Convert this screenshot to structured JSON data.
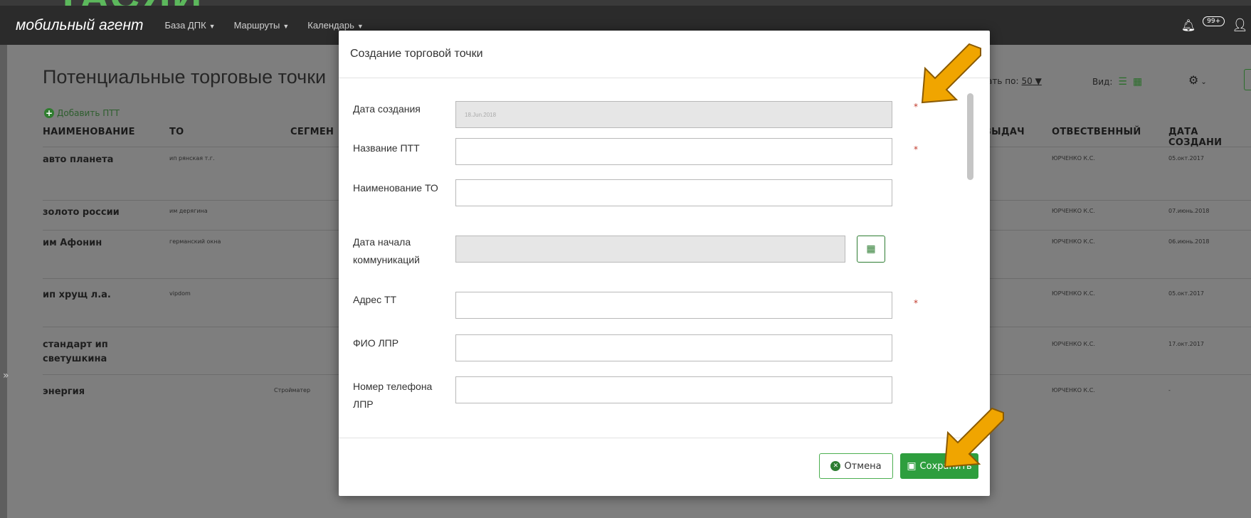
{
  "frame": {
    "title_fragment": "ТАСЯИ"
  },
  "nav": {
    "brand": "мобильный агент",
    "items": [
      {
        "label": "База ДПК"
      },
      {
        "label": "Маршруты"
      },
      {
        "label": "Календарь"
      }
    ],
    "badge": "99+",
    "icons": {
      "bell": "bell-icon",
      "user": "user-icon"
    }
  },
  "page": {
    "title": "Потенциальные торговые точки",
    "add_label": "Добавить ПТТ",
    "show_by_label": "вать по:",
    "show_by_value": "50",
    "view_label": "Вид:",
    "sidebar_toggle": "»"
  },
  "table": {
    "columns": {
      "name": "НАИМЕНОВАНИЕ",
      "to": "ТО",
      "segment": "СЕГМЕН",
      "issue": "I ВЫДАЧ",
      "responsible": "ОТВЕСТВЕННЫЙ",
      "created": "ДАТА СОЗДАНИ"
    },
    "rows": [
      {
        "name": "авто планета",
        "to": "ип рянская т.г.",
        "segment": "",
        "responsible": "ЮРЧЕНКО К.С.",
        "created": "05.окт.2017"
      },
      {
        "name": "золото россии",
        "to": "им дерягина",
        "segment": "",
        "responsible": "ЮРЧЕНКО К.С.",
        "created": "07.июнь.2018"
      },
      {
        "name": "им Афонин",
        "to": "германский окна",
        "segment": "",
        "responsible": "ЮРЧЕНКО К.С.",
        "created": "06.июнь.2018"
      },
      {
        "name": "ип хрущ л.а.",
        "to": "vipdom",
        "segment": "",
        "responsible": "ЮРЧЕНКО К.С.",
        "created": "05.окт.2017"
      },
      {
        "name": "стандарт ип светушкина",
        "to": "",
        "segment": "",
        "responsible": "ЮРЧЕНКО К.С.",
        "created": "17.окт.2017"
      },
      {
        "name": "энергия",
        "to": "",
        "segment": "Стройматер",
        "responsible": "ЮРЧЕНКО К.С.",
        "created": "-"
      }
    ]
  },
  "modal": {
    "title": "Создание торговой точки",
    "close": "×",
    "fields": {
      "created_date": {
        "label": "Дата создания",
        "value": "18.Jun.2018"
      },
      "ptt_name": {
        "label": "Название ПТТ",
        "value": ""
      },
      "to_name": {
        "label": "Наименование ТО",
        "value": ""
      },
      "comm_start": {
        "label": "Дата начала коммуникаций",
        "value": ""
      },
      "address": {
        "label": "Адрес ТТ",
        "value": ""
      },
      "lpr_name": {
        "label": "ФИО ЛПР",
        "value": ""
      },
      "lpr_phone": {
        "label": "Номер телефона ЛПР",
        "value": ""
      }
    },
    "required_mark": "*",
    "cancel_label": "Отмена",
    "save_label": "Сохранить"
  },
  "colors": {
    "accent_green": "#2e9e3e",
    "required_red": "#c0392b",
    "arrow_orange": "#f0a500"
  }
}
